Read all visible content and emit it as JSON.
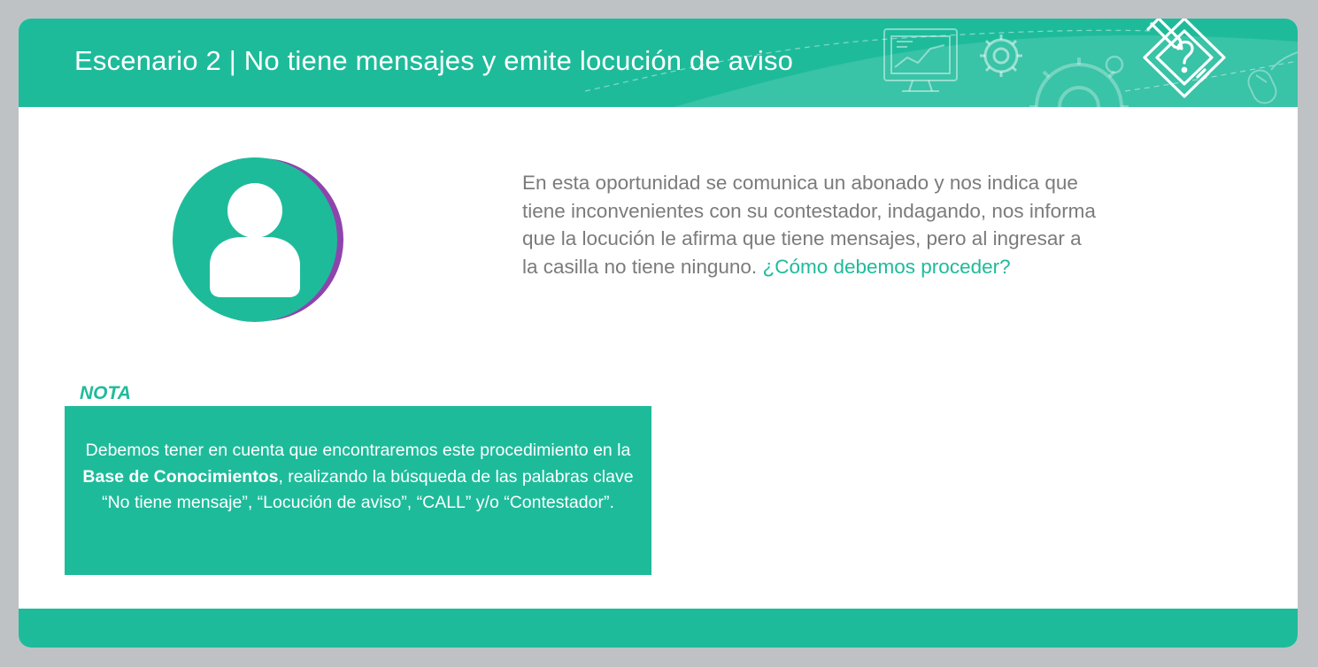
{
  "slide": {
    "title": "Escenario 2 | No tiene mensajes y emite locución de aviso",
    "icons": [
      "monitor-chart-icon",
      "gear-icon",
      "large-gear-icon",
      "mouse-icon",
      "pencil-question-badge-icon",
      "user-avatar-icon"
    ]
  },
  "description": {
    "text": "En esta oportunidad se comunica un abonado y nos indica que tiene inconvenientes con su contestador, indagando, nos informa que la locución le afirma que tiene mensajes, pero al ingresar a la casilla no tiene ninguno.",
    "question": "¿Cómo debemos proceder?"
  },
  "note": {
    "label": "NOTA",
    "text_before": "Debemos tener en cuenta que encontraremos este procedimiento en la",
    "bold": "Base de Conocimientos",
    "text_after": ", realizando la búsqueda de las palabras clave “No tiene mensaje”, “Locución de aviso”, “CALL” y/o “Contestador”."
  },
  "colors": {
    "accent": "#1ebb9b",
    "avatar_shadow": "#8e44ad",
    "body_text": "#7b7b7b",
    "background": "#bfc2c5"
  }
}
